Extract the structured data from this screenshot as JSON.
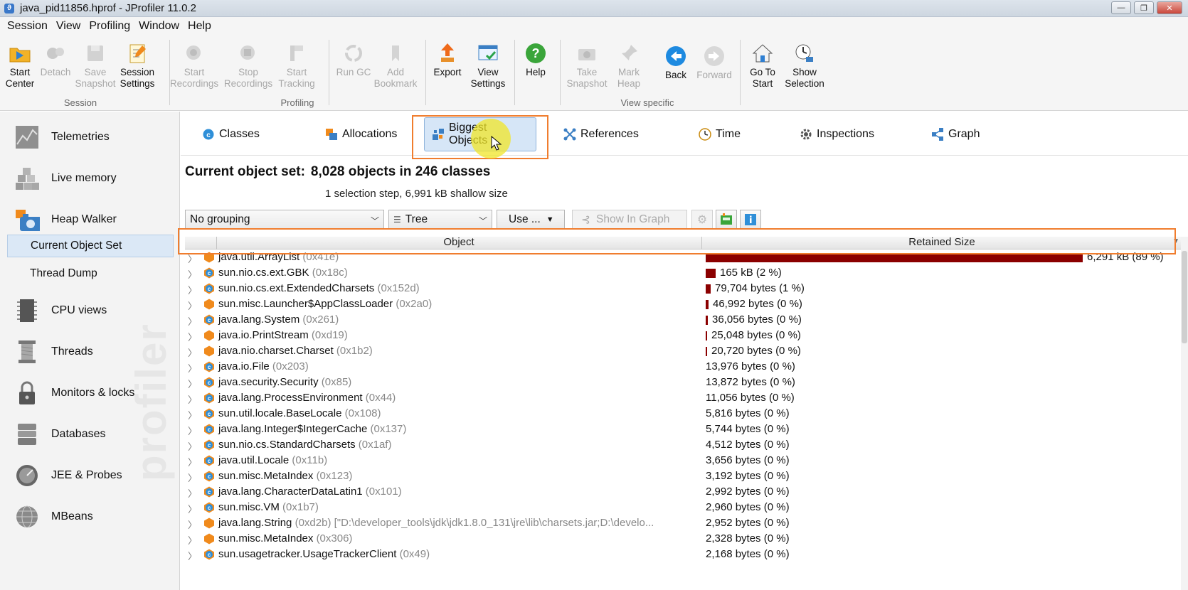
{
  "window": {
    "title": "java_pid11856.hprof - JProfiler 11.0.2",
    "controls": [
      "minimize",
      "maximize",
      "close"
    ]
  },
  "menu": [
    "Session",
    "View",
    "Profiling",
    "Window",
    "Help"
  ],
  "toolbar": {
    "groups": {
      "session": "Session",
      "profiling": "Profiling",
      "view_specific": "View specific"
    },
    "buttons": {
      "start_center": "Start\nCenter",
      "detach": "Detach",
      "save_snapshot": "Save\nSnapshot",
      "session_settings": "Session\nSettings",
      "start_recordings": "Start\nRecordings",
      "stop_recordings": "Stop\nRecordings",
      "start_tracking": "Start\nTracking",
      "run_gc": "Run GC",
      "add_bookmark": "Add\nBookmark",
      "export": "Export",
      "view_settings": "View\nSettings",
      "help": "Help",
      "take_snapshot": "Take\nSnapshot",
      "mark_heap": "Mark\nHeap",
      "back": "Back",
      "forward": "Forward",
      "go_to_start": "Go To\nStart",
      "show_selection": "Show\nSelection"
    }
  },
  "nav": {
    "telemetries": "Telemetries",
    "live_memory": "Live memory",
    "heap_walker": "Heap Walker",
    "current_object_set": "Current Object Set",
    "thread_dump": "Thread Dump",
    "cpu_views": "CPU views",
    "threads": "Threads",
    "monitors_locks": "Monitors & locks",
    "databases": "Databases",
    "jee_probes": "JEE & Probes",
    "mbeans": "MBeans",
    "watermark": "profiler"
  },
  "tabs": {
    "classes": "Classes",
    "allocations": "Allocations",
    "biggest_objects": "Biggest Objects",
    "references": "References",
    "time": "Time",
    "inspections": "Inspections",
    "graph": "Graph"
  },
  "object_set": {
    "label": "Current object set:",
    "value": "8,028 objects in 246 classes",
    "detail": "1 selection step, 6,991 kB shallow size"
  },
  "controls": {
    "grouping": "No grouping",
    "view_mode": "Tree",
    "use": "Use ...",
    "show_in_graph": "Show In Graph"
  },
  "table": {
    "columns": [
      "Object",
      "Retained Size"
    ],
    "rows": [
      {
        "icon": "object",
        "name": "java.util.ArrayList",
        "id": "(0x41e)",
        "size": "6,291 kB (89 %)",
        "fraction": 0.89
      },
      {
        "icon": "class",
        "name": "sun.nio.cs.ext.GBK",
        "id": "(0x18c)",
        "size": "165 kB (2 %)",
        "fraction": 0.024
      },
      {
        "icon": "class",
        "name": "sun.nio.cs.ext.ExtendedCharsets",
        "id": "(0x152d)",
        "size": "79,704 bytes (1 %)",
        "fraction": 0.011
      },
      {
        "icon": "object",
        "name": "sun.misc.Launcher$AppClassLoader",
        "id": "(0x2a0)",
        "size": "46,992 bytes (0 %)",
        "fraction": 0.0067
      },
      {
        "icon": "class",
        "name": "java.lang.System",
        "id": "(0x261)",
        "size": "36,056 bytes (0 %)",
        "fraction": 0.0051
      },
      {
        "icon": "object",
        "name": "java.io.PrintStream",
        "id": "(0xd19)",
        "size": "25,048 bytes (0 %)",
        "fraction": 0.0036
      },
      {
        "icon": "object",
        "name": "java.nio.charset.Charset",
        "id": "(0x1b2)",
        "size": "20,720 bytes (0 %)",
        "fraction": 0.003
      },
      {
        "icon": "class",
        "name": "java.io.File",
        "id": "(0x203)",
        "size": "13,976 bytes (0 %)",
        "fraction": 0
      },
      {
        "icon": "class",
        "name": "java.security.Security",
        "id": "(0x85)",
        "size": "13,872 bytes (0 %)",
        "fraction": 0
      },
      {
        "icon": "class",
        "name": "java.lang.ProcessEnvironment",
        "id": "(0x44)",
        "size": "11,056 bytes (0 %)",
        "fraction": 0
      },
      {
        "icon": "class",
        "name": "sun.util.locale.BaseLocale",
        "id": "(0x108)",
        "size": "5,816 bytes (0 %)",
        "fraction": 0
      },
      {
        "icon": "class",
        "name": "java.lang.Integer$IntegerCache",
        "id": "(0x137)",
        "size": "5,744 bytes (0 %)",
        "fraction": 0
      },
      {
        "icon": "class",
        "name": "sun.nio.cs.StandardCharsets",
        "id": "(0x1af)",
        "size": "4,512 bytes (0 %)",
        "fraction": 0
      },
      {
        "icon": "class",
        "name": "java.util.Locale",
        "id": "(0x11b)",
        "size": "3,656 bytes (0 %)",
        "fraction": 0
      },
      {
        "icon": "class",
        "name": "sun.misc.MetaIndex",
        "id": "(0x123)",
        "size": "3,192 bytes (0 %)",
        "fraction": 0
      },
      {
        "icon": "class",
        "name": "java.lang.CharacterDataLatin1",
        "id": "(0x101)",
        "size": "2,992 bytes (0 %)",
        "fraction": 0
      },
      {
        "icon": "class",
        "name": "sun.misc.VM",
        "id": "(0x1b7)",
        "size": "2,960 bytes (0 %)",
        "fraction": 0
      },
      {
        "icon": "object",
        "name": "java.lang.String",
        "id": "(0xd2b) [\"D:\\developer_tools\\jdk\\jdk1.8.0_131\\jre\\lib\\charsets.jar;D:\\develo...",
        "size": "2,952 bytes (0 %)",
        "fraction": 0
      },
      {
        "icon": "object",
        "name": "sun.misc.MetaIndex",
        "id": "(0x306)",
        "size": "2,328 bytes (0 %)",
        "fraction": 0
      },
      {
        "icon": "class",
        "name": "sun.usagetracker.UsageTrackerClient",
        "id": "(0x49)",
        "size": "2,168 bytes (0 %)",
        "fraction": 0
      }
    ]
  },
  "colors": {
    "bar": "#8b0000",
    "highlight": "#f07d2e",
    "class_icon": "#2f8fd8",
    "object_icon": "#f08a1c"
  }
}
